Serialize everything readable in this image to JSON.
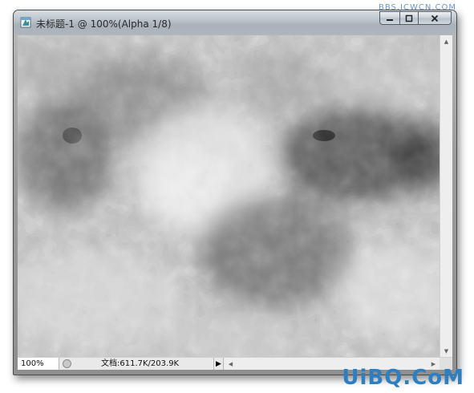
{
  "watermark_top": "BBS.JCWCN.COM",
  "window": {
    "title": "未标题-1 @ 100%(Alpha 1/8)",
    "icon": "photoshop-document-icon",
    "controls": {
      "minimize": "minimize-icon",
      "maximize": "maximize-icon",
      "close": "close-icon"
    }
  },
  "canvas": {
    "description_icon": "crystallize-texture",
    "colors": {
      "base": "#bdbdbd",
      "light": "#e6e6e6",
      "dark": "#2a2a2a"
    }
  },
  "statusbar": {
    "zoom": "100%",
    "doc_info": "文档:611.7K/203.9K"
  },
  "watermark_bottom": "UiBQ.CoM"
}
